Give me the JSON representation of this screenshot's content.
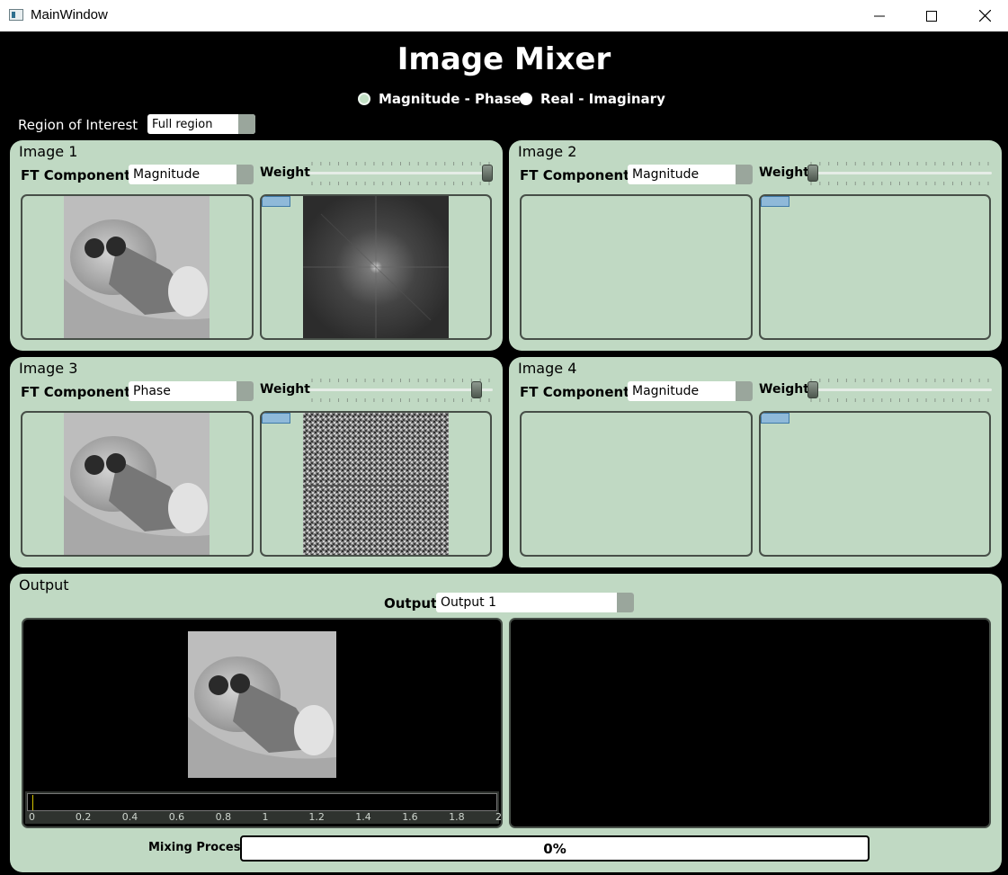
{
  "window": {
    "title": "MainWindow",
    "minimize_icon": "minimize-icon",
    "maximize_icon": "maximize-icon",
    "close_icon": "close-icon"
  },
  "header": {
    "title": "Image Mixer"
  },
  "mode": {
    "options": [
      "Magnitude - Phase",
      "Real - Imaginary"
    ],
    "selected": "Magnitude - Phase"
  },
  "roi": {
    "label": "Region of Interest",
    "value": "Full region"
  },
  "images": [
    {
      "title": "Image 1",
      "ft_label": "FT Components",
      "ft_value": "Magnitude",
      "weight_label": "Weight",
      "weight": 1.0
    },
    {
      "title": "Image 2",
      "ft_label": "FT Components",
      "ft_value": "Magnitude",
      "weight_label": "Weight",
      "weight": 0.0
    },
    {
      "title": "Image 3",
      "ft_label": "FT Components",
      "ft_value": "Phase",
      "weight_label": "Weight",
      "weight": 0.94
    },
    {
      "title": "Image 4",
      "ft_label": "FT Components",
      "ft_value": "Magnitude",
      "weight_label": "Weight",
      "weight": 0.0
    }
  ],
  "output": {
    "title": "Output",
    "select_label": "Output",
    "select_value": "Output 1",
    "timeline_ticks": [
      "0",
      "0.2",
      "0.4",
      "0.6",
      "0.8",
      "1",
      "1.2",
      "1.4",
      "1.6",
      "1.8",
      "2"
    ],
    "mixing_label": "Mixing Process",
    "progress_text": "0%",
    "progress": 0
  },
  "colors": {
    "panel_bg": "#c0d9c3",
    "viewer_border": "#474f48",
    "app_bg": "#000000"
  }
}
